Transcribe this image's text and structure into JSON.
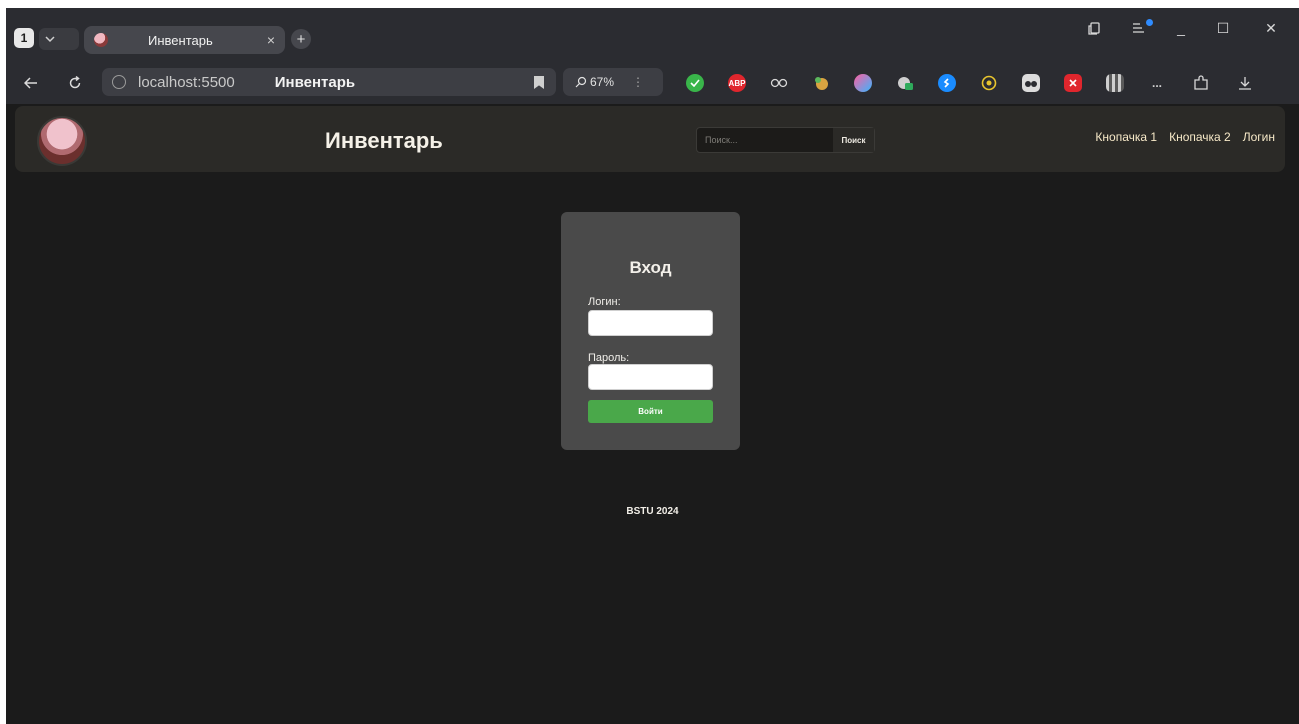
{
  "browser": {
    "tab_count": "1",
    "tab_title": "Инвентарь",
    "tab_close": "×",
    "new_tab": "+",
    "url_host": "localhost:5500",
    "url_title": "Инвентарь",
    "zoom": "67%",
    "zoom_menu": "⋮",
    "ext_abp": "ABP",
    "more_ext": "...",
    "window_min": "_",
    "window_max": "☐",
    "window_close": "✕"
  },
  "header": {
    "site_title": "Инвентарь",
    "search_placeholder": "Поиск...",
    "search_button": "Поиск",
    "nav": [
      "Кнопачка 1",
      "Кнопачка 2",
      "Логин"
    ]
  },
  "login": {
    "title": "Вход",
    "login_label": "Логин:",
    "password_label": "Пароль:",
    "submit": "Войти"
  },
  "footer": {
    "text": "BSTU 2024"
  },
  "colors": {
    "page_bg": "#1b1b1b",
    "header_bg": "#2b2a27",
    "card_bg": "#4a4a4a",
    "button_green": "#4aa84a",
    "nav_text": "#f7e9c8"
  }
}
